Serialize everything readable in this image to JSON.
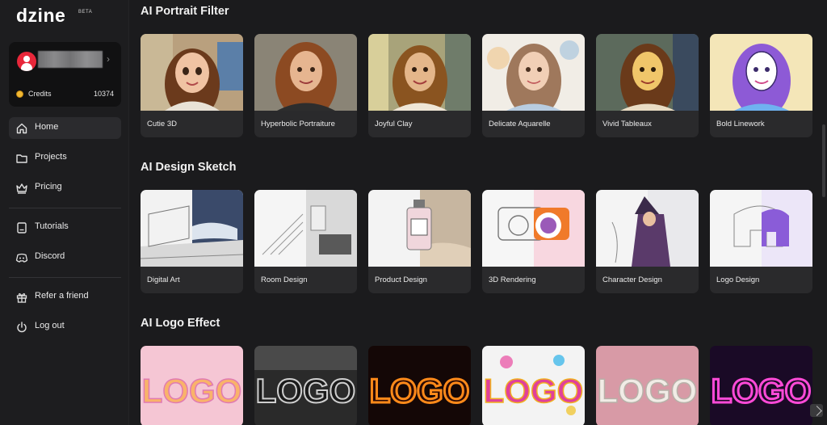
{
  "brand": {
    "name": "dzine",
    "badge": "BETA"
  },
  "user": {
    "credits_label": "Credits",
    "credits_value": "10374"
  },
  "nav": {
    "primary": [
      {
        "label": "Home",
        "icon": "home-icon",
        "active": true
      },
      {
        "label": "Projects",
        "icon": "folder-icon"
      },
      {
        "label": "Pricing",
        "icon": "crown-icon"
      }
    ],
    "secondary": [
      {
        "label": "Tutorials",
        "icon": "book-icon"
      },
      {
        "label": "Discord",
        "icon": "discord-icon"
      }
    ],
    "tertiary": [
      {
        "label": "Refer a friend",
        "icon": "gift-icon"
      },
      {
        "label": "Log out",
        "icon": "power-icon"
      }
    ]
  },
  "sections": [
    {
      "title": "AI Portrait Filter",
      "cards": [
        {
          "label": "Cutie 3D"
        },
        {
          "label": "Hyperbolic Portraiture"
        },
        {
          "label": "Joyful Clay"
        },
        {
          "label": "Delicate Aquarelle"
        },
        {
          "label": "Vivid Tableaux"
        },
        {
          "label": "Bold Linework"
        }
      ]
    },
    {
      "title": "AI Design Sketch",
      "cards": [
        {
          "label": "Digital Art"
        },
        {
          "label": "Room Design"
        },
        {
          "label": "Product Design"
        },
        {
          "label": "3D Rendering"
        },
        {
          "label": "Character Design"
        },
        {
          "label": "Logo Design"
        }
      ]
    },
    {
      "title": "AI Logo Effect",
      "cards": [
        {
          "text": "LOGO"
        },
        {
          "text": "LOGO"
        },
        {
          "text": "LOGO"
        },
        {
          "text": "LOGO"
        },
        {
          "text": "LOGO"
        },
        {
          "text": "LOGO"
        }
      ]
    }
  ]
}
